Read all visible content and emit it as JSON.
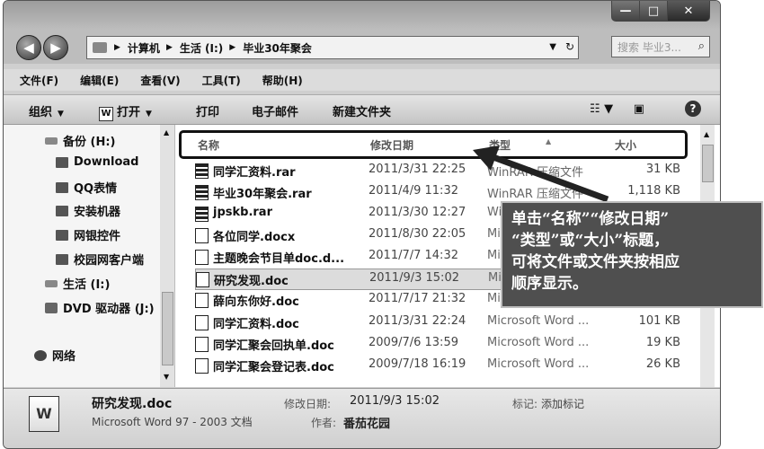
{
  "window": {
    "buttons": {
      "minimize": "—",
      "maximize": "□",
      "close": "✕"
    }
  },
  "nav": {
    "back": "◀",
    "forward": "▶",
    "breadcrumb": [
      "计算机",
      "生活 (I:)",
      "毕业30年聚会"
    ],
    "search_placeholder": "搜索 毕业3...",
    "search_icon": "search-icon"
  },
  "menu": [
    "文件(F)",
    "编辑(E)",
    "查看(V)",
    "工具(T)",
    "帮助(H)"
  ],
  "toolbar": {
    "organize": "组织",
    "open": "打开",
    "print": "打印",
    "email": "电子邮件",
    "new_folder": "新建文件夹"
  },
  "sidebar": {
    "items": [
      {
        "label": "备份 (H:)",
        "icon": "drive-icon"
      },
      {
        "label": "Download",
        "icon": "folder-icon"
      },
      {
        "label": "QQ表情",
        "icon": "folder-icon"
      },
      {
        "label": "安装机器",
        "icon": "folder-icon"
      },
      {
        "label": "网银控件",
        "icon": "folder-icon"
      },
      {
        "label": "校园网客户端",
        "icon": "folder-icon"
      },
      {
        "label": "生活 (I:)",
        "icon": "drive-icon"
      },
      {
        "label": "DVD 驱动器 (J:)",
        "icon": "dvd-icon"
      },
      {
        "label": "网络",
        "icon": "network-icon"
      }
    ]
  },
  "columns": {
    "name": "名称",
    "modified": "修改日期",
    "type": "类型",
    "size": "大小"
  },
  "files": [
    {
      "name": "同学汇资料.rar",
      "date": "2011/3/31 22:25",
      "type": "WinRAR 压缩文件",
      "size": "31 KB",
      "kind": "rar"
    },
    {
      "name": "毕业30年聚会.rar",
      "date": "2011/4/9 11:32",
      "type": "WinRAR 压缩文件",
      "size": "1,118 KB",
      "kind": "rar"
    },
    {
      "name": "jpskb.rar",
      "date": "2011/3/30 12:27",
      "type": "Wi",
      "size": "",
      "kind": "rar"
    },
    {
      "name": "各位同学.docx",
      "date": "2011/8/30 22:05",
      "type": "Mi",
      "size": "",
      "kind": "doc"
    },
    {
      "name": "主题晚会节目单doc.d...",
      "date": "2011/7/7 14:32",
      "type": "Mi",
      "size": "",
      "kind": "doc"
    },
    {
      "name": "研究发现.doc",
      "date": "2011/9/3 15:02",
      "type": "Mi",
      "size": "",
      "kind": "doc"
    },
    {
      "name": "薛向东你好.doc",
      "date": "2011/7/17 21:32",
      "type": "Mi",
      "size": "",
      "kind": "doc"
    },
    {
      "name": "同学汇资料.doc",
      "date": "2011/3/31 22:24",
      "type": "Microsoft Word ...",
      "size": "101 KB",
      "kind": "doc"
    },
    {
      "name": "同学汇聚会回执单.doc",
      "date": "2009/7/6 13:59",
      "type": "Microsoft Word ...",
      "size": "19 KB",
      "kind": "doc"
    },
    {
      "name": "同学汇聚会登记表.doc",
      "date": "2009/7/18 16:19",
      "type": "Microsoft Word ...",
      "size": "26 KB",
      "kind": "doc"
    }
  ],
  "details": {
    "name": "研究发现.doc",
    "type": "Microsoft Word 97 - 2003 文档",
    "modified_label": "修改日期:",
    "modified_value": "2011/9/3 15:02",
    "tags_label": "标记:",
    "tags_value": "添加标记",
    "author_label": "作者:",
    "author_value": "番茄花园",
    "icon_letter": "W"
  },
  "callout": {
    "lines": [
      "单击“名称”“修改日期”",
      "“类型”或“大小”标题，",
      "可将文件或文件夹按相应",
      "顺序显示。"
    ]
  }
}
